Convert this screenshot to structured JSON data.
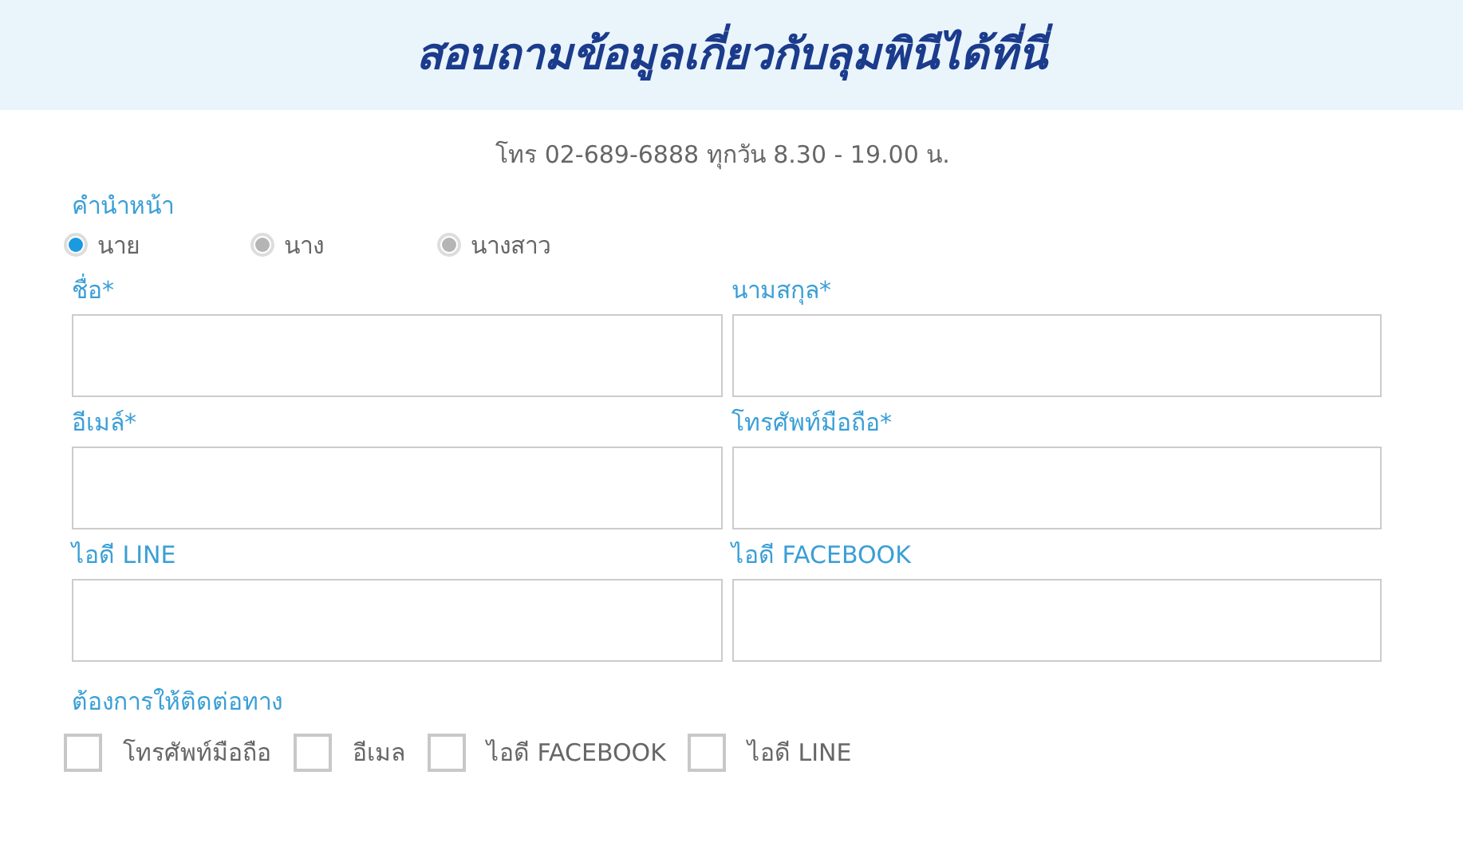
{
  "header": {
    "title": "สอบถามข้อมูลเกี่ยวกับลุมพินีได้ที่นี่"
  },
  "contact_line": "โทร 02-689-6888 ทุกวัน 8.30 - 19.00 น.",
  "title_group": {
    "label": "คำนำหน้า",
    "options": [
      {
        "label": "นาย",
        "selected": true
      },
      {
        "label": "นาง",
        "selected": false
      },
      {
        "label": "นางสาว",
        "selected": false
      }
    ]
  },
  "fields": [
    {
      "label": "ชื่อ*"
    },
    {
      "label": "นามสกุล*"
    },
    {
      "label": "อีเมล์*"
    },
    {
      "label": "โทรศัพท์มือถือ*"
    },
    {
      "label": "ไอดี LINE"
    },
    {
      "label": "ไอดี FACEBOOK"
    }
  ],
  "contact_methods": {
    "label": "ต้องการให้ติดต่อทาง",
    "options": [
      {
        "label": "โทรศัพท์มือถือ",
        "checked": false
      },
      {
        "label": "อีเมล",
        "checked": false
      },
      {
        "label": "ไอดี FACEBOOK",
        "checked": false
      },
      {
        "label": "ไอดี LINE",
        "checked": false
      }
    ]
  }
}
